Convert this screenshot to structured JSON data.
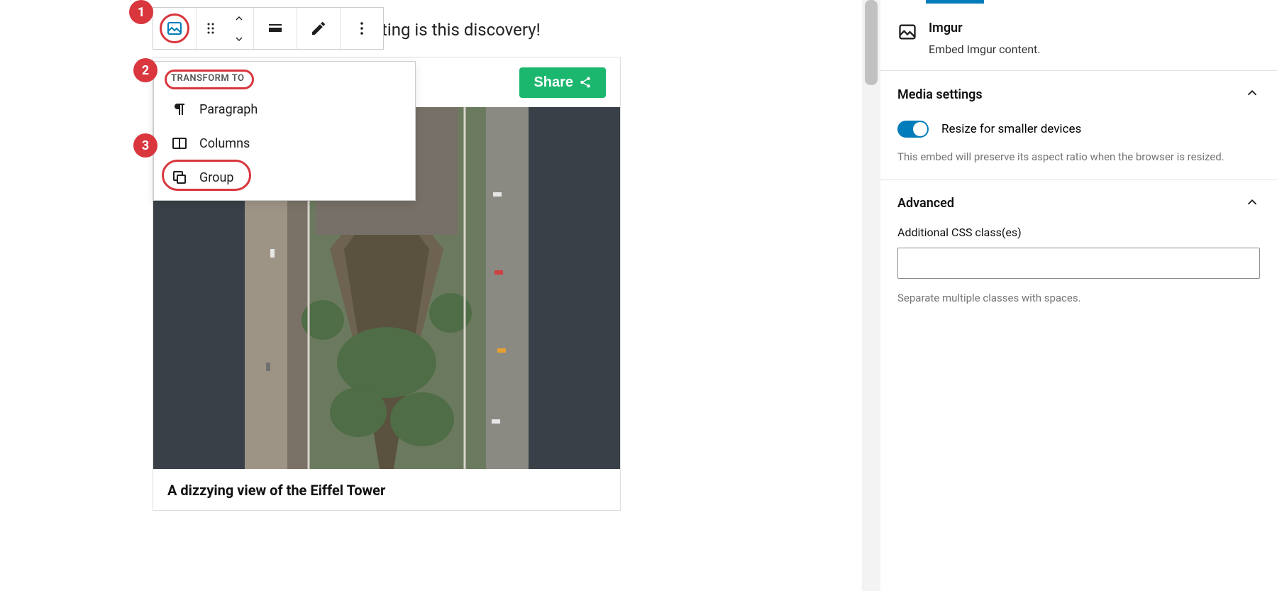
{
  "editor_text_fragment": "ating is this discovery!",
  "toolbar": {
    "block_icon": "imgur-icon",
    "drag_icon": "drag-handle-icon",
    "move_up_icon": "chevron-up-icon",
    "move_down_icon": "chevron-down-icon",
    "align_icon": "align-icon",
    "edit_icon": "pencil-icon",
    "more_icon": "ellipsis-icon"
  },
  "transform": {
    "header": "TRANSFORM TO",
    "items": [
      {
        "label": "Paragraph",
        "icon": "pilcrow-icon"
      },
      {
        "label": "Columns",
        "icon": "columns-icon"
      },
      {
        "label": "Group",
        "icon": "group-icon"
      }
    ]
  },
  "embed": {
    "share_label": "Share",
    "caption": "A dizzying view of the Eiffel Tower"
  },
  "sidebar": {
    "block_name": "Imgur",
    "block_description": "Embed Imgur content.",
    "media_settings_title": "Media settings",
    "resize_label": "Resize for smaller devices",
    "resize_help": "This embed will preserve its aspect ratio when the browser is resized.",
    "advanced_title": "Advanced",
    "css_label": "Additional CSS class(es)",
    "css_help": "Separate multiple classes with spaces.",
    "css_value": ""
  },
  "callouts": {
    "one": "1",
    "two": "2",
    "three": "3"
  }
}
